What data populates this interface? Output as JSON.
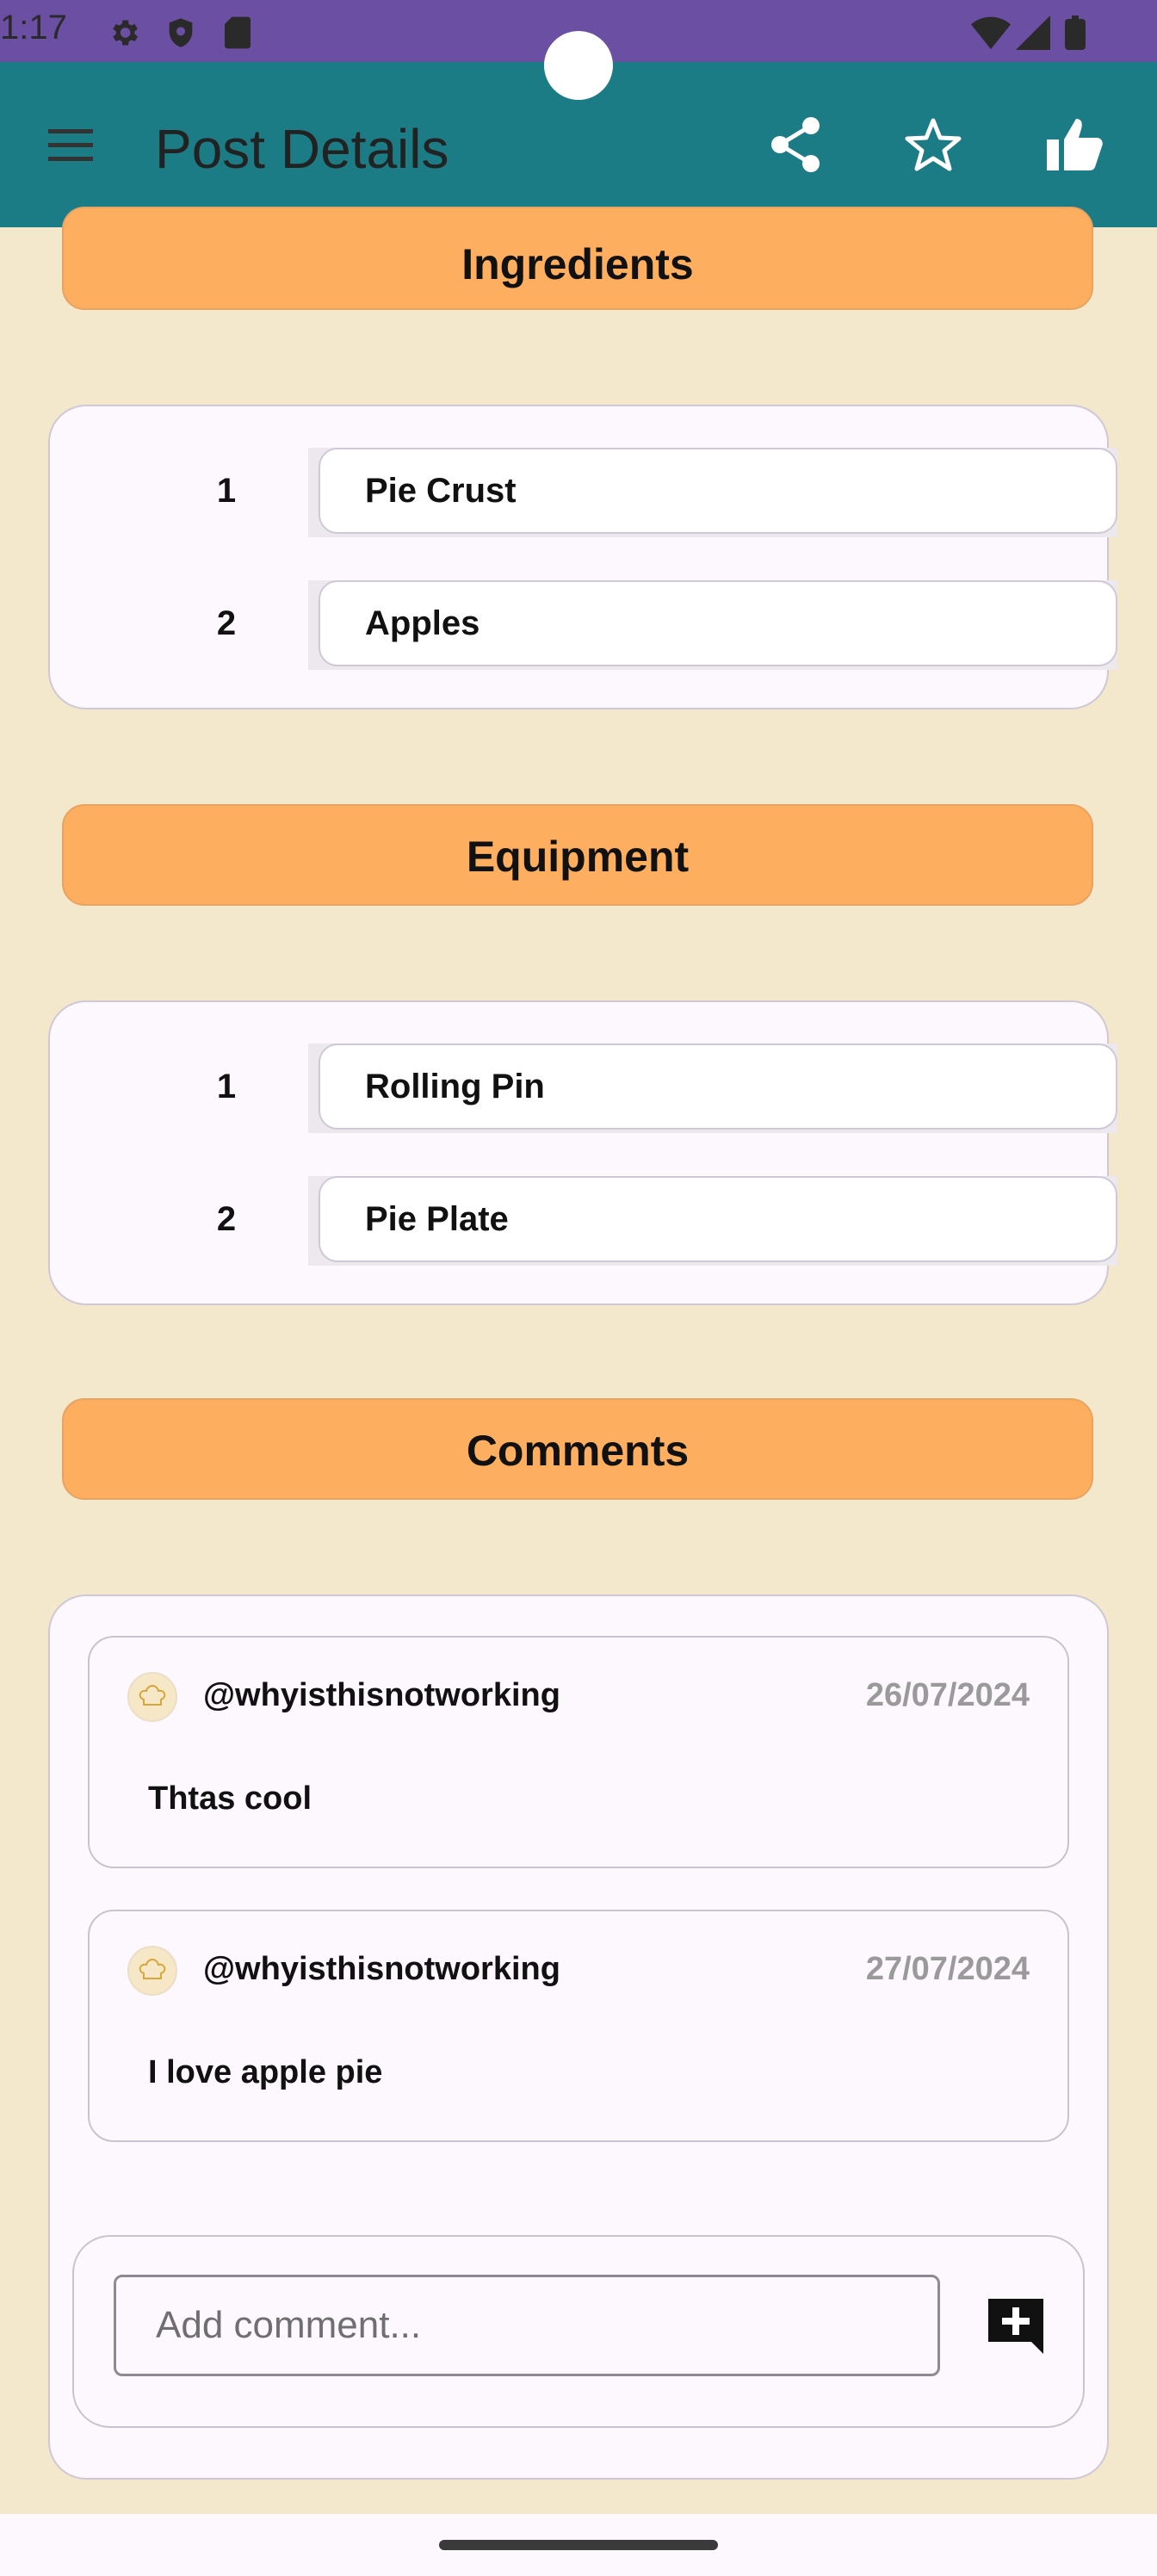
{
  "status_bar": {
    "time": "1:17"
  },
  "app_bar": {
    "title": "Post Details",
    "icons": [
      "menu-icon",
      "share-icon",
      "star-icon",
      "thumbs-up-icon"
    ]
  },
  "ingredients": {
    "header": "Ingredients",
    "items": [
      {
        "num": "1",
        "name": "Pie Crust"
      },
      {
        "num": "2",
        "name": "Apples"
      }
    ]
  },
  "equipment": {
    "header": "Equipment",
    "items": [
      {
        "num": "1",
        "name": "Rolling Pin"
      },
      {
        "num": "2",
        "name": "Pie Plate"
      }
    ]
  },
  "comments": {
    "header": "Comments",
    "items": [
      {
        "user": "@whyisthisnotworking",
        "date": "26/07/2024",
        "text": "Thtas cool"
      },
      {
        "user": "@whyisthisnotworking",
        "date": "27/07/2024",
        "text": "I love apple pie"
      }
    ],
    "add_placeholder": "Add comment..."
  },
  "colors": {
    "status_bar": "#6A4FA3",
    "app_bar": "#1C7C86",
    "background": "#F3E7CC",
    "section_header": "#FDAE5E",
    "card": "#FDF7FE"
  }
}
